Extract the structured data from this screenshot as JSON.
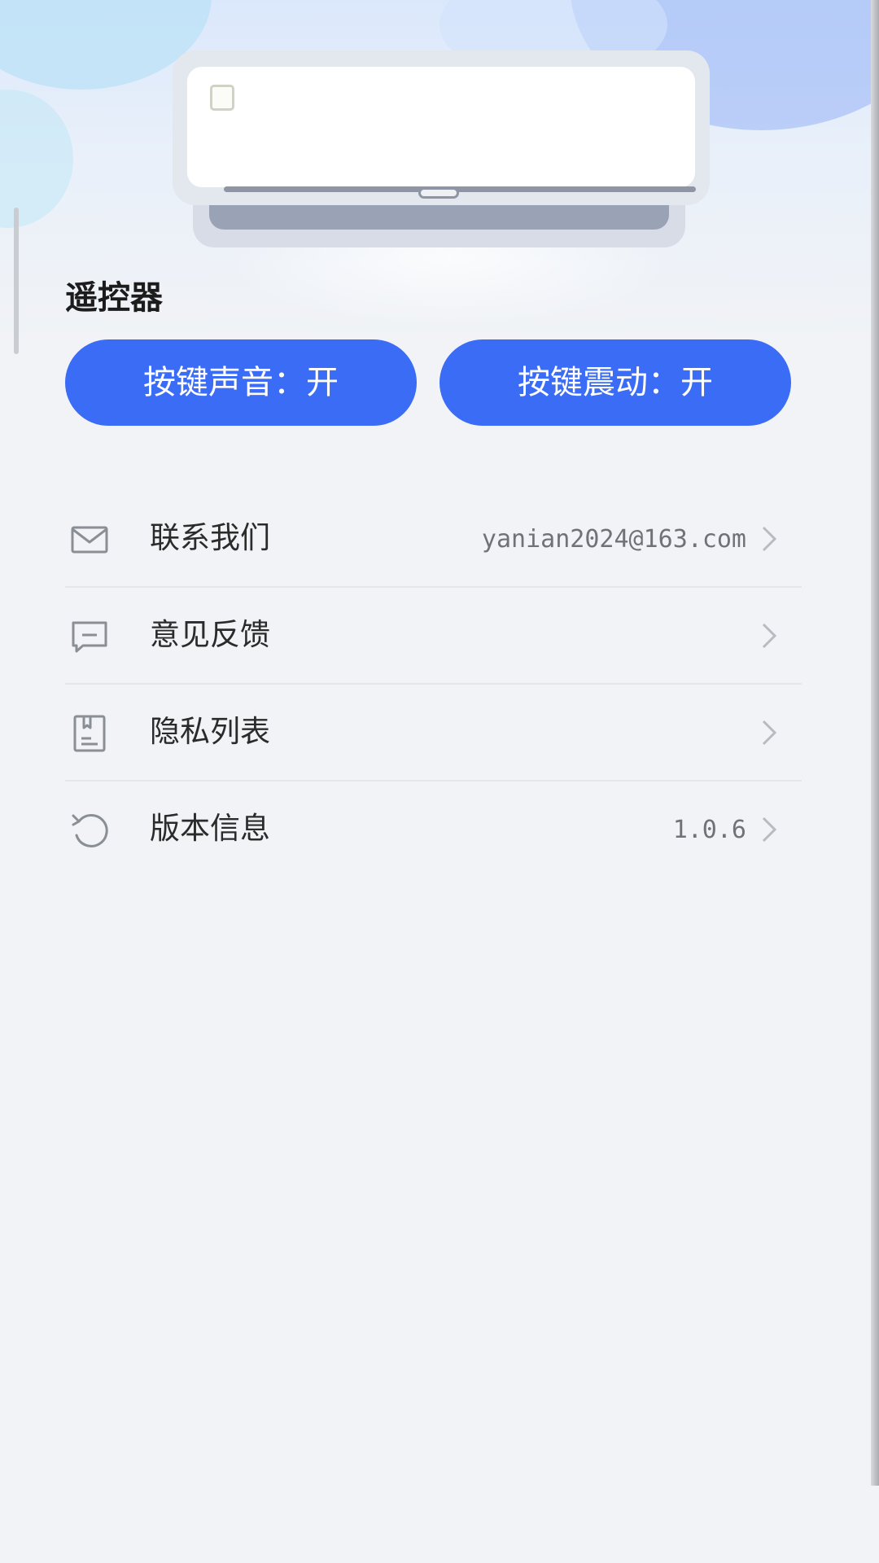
{
  "header": {
    "title": "遥控器"
  },
  "illustration": {
    "icon": "air-conditioner-icon"
  },
  "toggles": {
    "sound_label": "按键声音：开",
    "vibration_label": "按键震动：开"
  },
  "settings": [
    {
      "label": "联系我们",
      "value": "yanian2024@163.com",
      "icon": "mail-icon"
    },
    {
      "label": "意见反馈",
      "value": "",
      "icon": "feedback-icon"
    },
    {
      "label": "隐私列表",
      "value": "",
      "icon": "privacy-icon"
    },
    {
      "label": "版本信息",
      "value": "1.0.6",
      "icon": "refresh-icon"
    }
  ],
  "colors": {
    "accent": "#3b6cf6",
    "background": "#f1f3f6",
    "text_primary": "#2b2b2b",
    "text_secondary": "#6f7378",
    "icon": "#8a8e95"
  }
}
